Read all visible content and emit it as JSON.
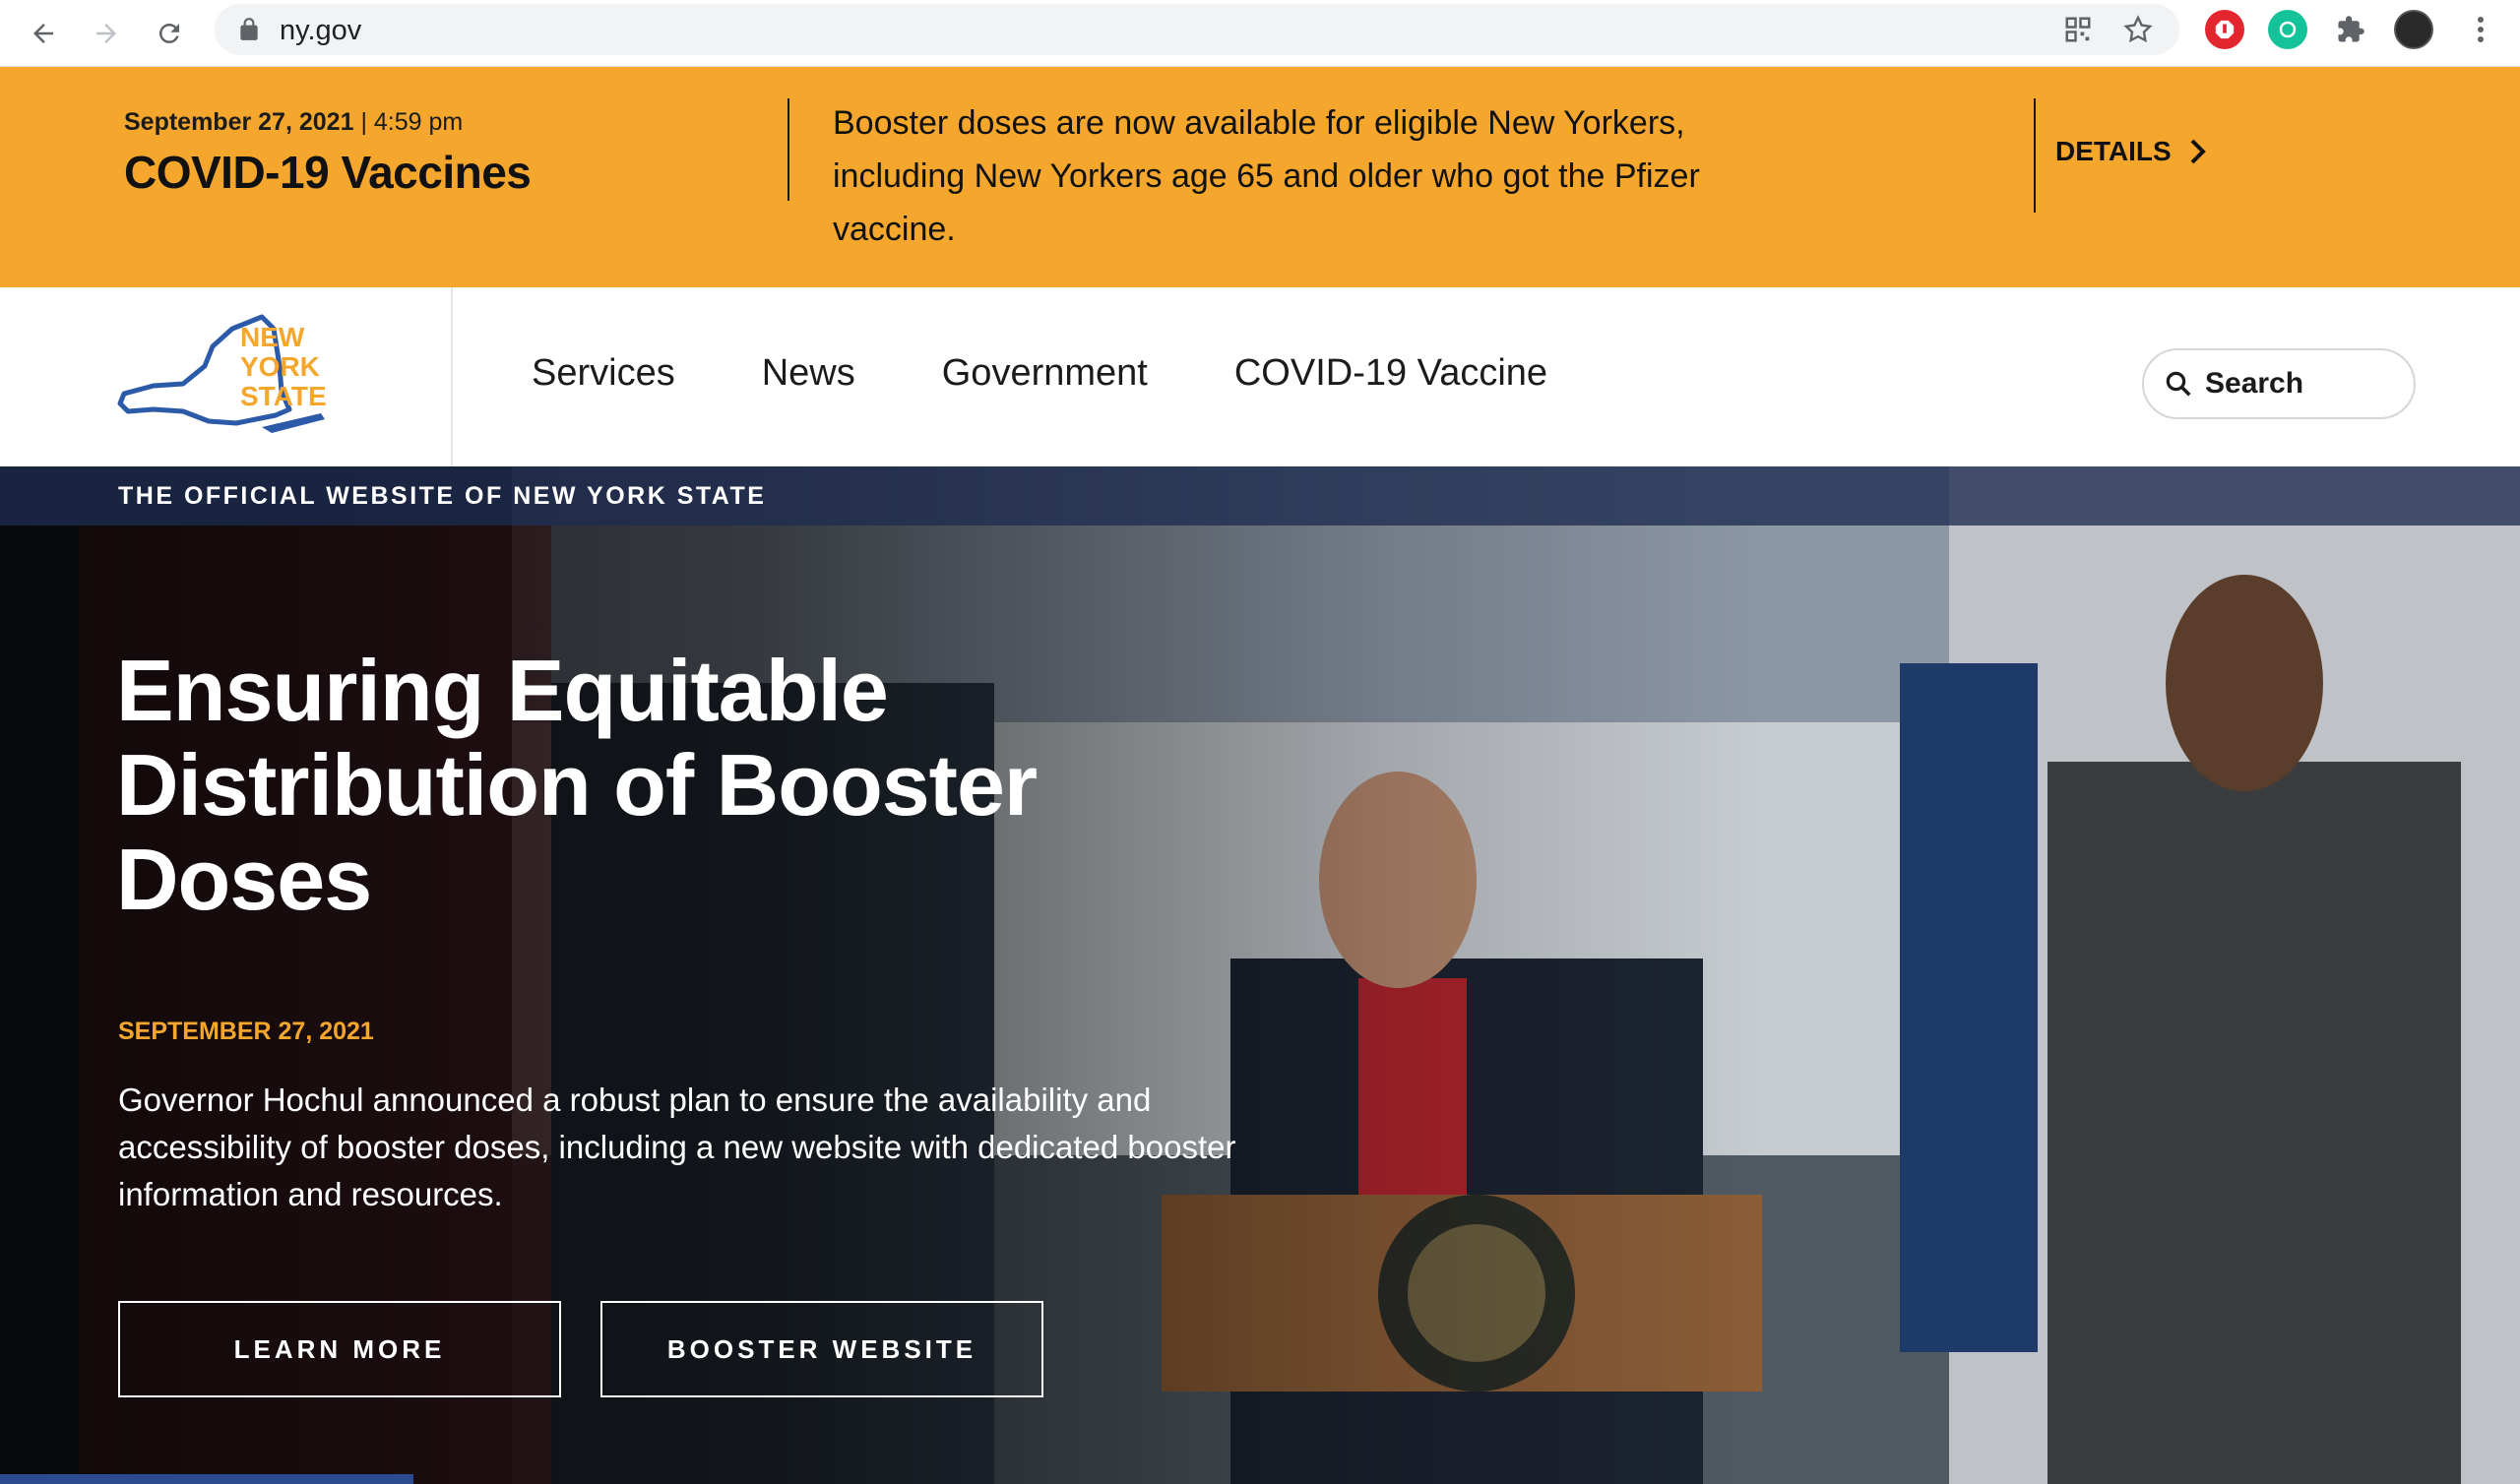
{
  "browser": {
    "url": "ny.gov",
    "back_icon": "back-arrow-icon",
    "forward_icon": "forward-arrow-icon",
    "reload_icon": "reload-icon"
  },
  "alert": {
    "date": "September 27, 2021",
    "time": "| 4:59 pm",
    "title": "COVID-19 Vaccines",
    "message": "Booster doses are now available for eligible New Yorkers, including New Yorkers age 65 and older who got the Pfizer vaccine.",
    "details_label": "DETAILS",
    "background": "#f4a72c"
  },
  "header": {
    "logo_lines": [
      "NEW",
      "YORK",
      "STATE"
    ],
    "menu": [
      "Services",
      "News",
      "Government",
      "COVID-19 Vaccine"
    ],
    "search_label": "Search"
  },
  "hero": {
    "official_label": "THE OFFICIAL WEBSITE OF NEW YORK STATE",
    "title": "Ensuring Equitable Distribution of Booster Doses",
    "date": "SEPTEMBER 27, 2021",
    "description": "Governor Hochul announced a robust plan to ensure the availability and accessibility of booster doses, including a new website with dedicated booster information and resources.",
    "buttons": [
      "LEARN MORE",
      "BOOSTER WEBSITE"
    ]
  },
  "colors": {
    "accent_orange": "#f4a72c",
    "logo_blue": "#2b5aa8",
    "navy": "#1e2c50"
  }
}
